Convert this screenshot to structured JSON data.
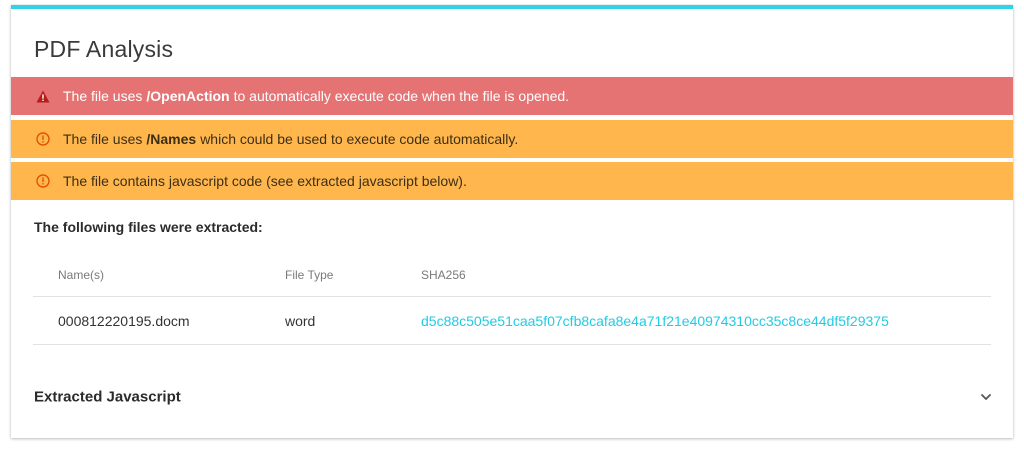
{
  "card": {
    "title": "PDF Analysis",
    "accent_color": "#2fd3ea"
  },
  "alerts": [
    {
      "level": "danger",
      "icon": "warning-triangle-icon",
      "color": "#e57373",
      "prefix": "The file uses",
      "keyword": "/OpenAction",
      "suffix": "to automatically execute code when the file is opened."
    },
    {
      "level": "warning",
      "icon": "warning-circle-icon",
      "color": "#ffb74d",
      "prefix": "The file uses",
      "keyword": "/Names",
      "suffix": "which could be used to execute code automatically."
    },
    {
      "level": "warning",
      "icon": "warning-circle-icon",
      "color": "#ffb74d",
      "text": "The file contains javascript code (see extracted javascript below)."
    }
  ],
  "extracted": {
    "heading": "The following files were extracted:",
    "columns": [
      "Name(s)",
      "File Type",
      "SHA256"
    ],
    "rows": [
      {
        "name": "000812220195.docm",
        "type": "word",
        "sha256": "d5c88c505e51caa5f07cfb8cafa8e4a71f21e40974310cc35c8ce44df5f29375"
      }
    ]
  },
  "javascript_section": {
    "label": "Extracted Javascript",
    "icon": "chevron-down-icon"
  }
}
